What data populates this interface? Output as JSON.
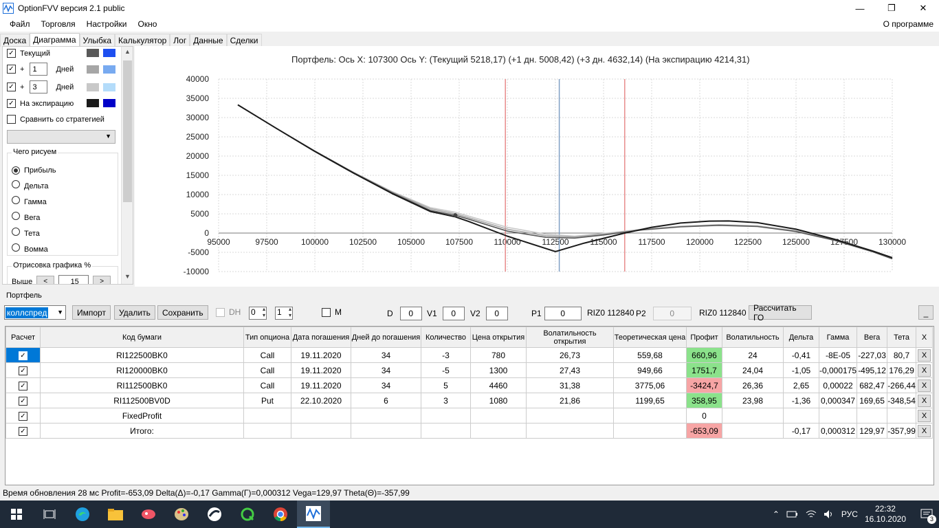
{
  "window": {
    "title": "OptionFVV версия 2.1 public",
    "controls": [
      "—",
      "❐",
      "✕"
    ]
  },
  "menu": {
    "items": [
      "Файл",
      "Торговля",
      "Настройки",
      "Окно"
    ],
    "about": "О программе"
  },
  "tabs": [
    "Доска",
    "Диаграмма",
    "Улыбка",
    "Калькулятор",
    "Лог",
    "Данные",
    "Сделки"
  ],
  "active_tab": "Диаграмма",
  "left_panel": {
    "current_label": "Текущий",
    "plus_sign": "+",
    "days_label": "Дней",
    "day1_value": "1",
    "day3_value": "3",
    "expiration_label": "На экспирацию",
    "compare_label": "Сравнить со стратегией",
    "draw_group_title": "Чего рисуем",
    "draw_options": [
      "Прибыль",
      "Дельта",
      "Гамма",
      "Вега",
      "Тета",
      "Вомма"
    ],
    "draw_selected": "Прибыль",
    "render_group_title": "Отрисовка графика %",
    "above_label": "Выше",
    "above_value": "15",
    "btn_less": "<",
    "btn_more": ">",
    "swatches": {
      "current": [
        "#595959",
        "#1e4ff0"
      ],
      "day1": [
        "#a6a6a6",
        "#78aaf0"
      ],
      "day3": [
        "#c8c8c8",
        "#b4dcfa"
      ],
      "expiration": [
        "#1a1a1a",
        "#0000c8"
      ]
    }
  },
  "chart_header": "Портфель: Ось X: 107300 Ось Y:  (Текущий 5218,17)  (+1 дн. 5008,42)  (+3 дн. 4632,14)  (На экспирацию 4214,31)",
  "chart_data": {
    "type": "line",
    "xlim": [
      95000,
      130000
    ],
    "ylim": [
      -10000,
      40000
    ],
    "x_ticks": [
      "95000",
      "97500",
      "100000",
      "102500",
      "105000",
      "107500",
      "110000",
      "112500",
      "115000",
      "117500",
      "120000",
      "122500",
      "125000",
      "127500",
      "130000"
    ],
    "y_ticks": [
      "40000",
      "35000",
      "30000",
      "25000",
      "20000",
      "15000",
      "10000",
      "5000",
      "0",
      "-5000",
      "-10000"
    ],
    "grid": true,
    "markers": [
      {
        "x": 109900,
        "color": "#e88a8a"
      },
      {
        "x": 112700,
        "color": "#7f9fc4"
      },
      {
        "x": 116100,
        "color": "#e88a8a"
      }
    ],
    "cursor_point": {
      "x": 107300,
      "y": 4632
    },
    "series": [
      {
        "color": "#c8c8c8",
        "x": [
          96000,
          98000,
          100000,
          102000,
          104000,
          106000,
          107300,
          108000,
          110000,
          112000,
          113500,
          115000,
          117000,
          119000,
          121000,
          123000,
          125000,
          127000,
          129000,
          130000
        ],
        "y": [
          33300,
          27200,
          21300,
          15800,
          10800,
          6600,
          5400,
          4400,
          1500,
          -300,
          -800,
          -100,
          1000,
          1800,
          2200,
          1900,
          600,
          -1600,
          -4600,
          -6400
        ]
      },
      {
        "color": "#a6a6a6",
        "x": [
          96000,
          98000,
          100000,
          102000,
          104000,
          106000,
          107300,
          108000,
          110000,
          112000,
          113500,
          115000,
          117000,
          119000,
          121000,
          123000,
          125000,
          127000,
          129000,
          130000
        ],
        "y": [
          33300,
          27200,
          21300,
          15800,
          10700,
          6300,
          5000,
          4000,
          1000,
          -700,
          -1000,
          -300,
          900,
          1700,
          2100,
          1800,
          500,
          -1800,
          -4800,
          -6600
        ]
      },
      {
        "color": "#595959",
        "x": [
          96000,
          98000,
          100000,
          102000,
          104000,
          106000,
          107300,
          108000,
          110000,
          112000,
          113500,
          115000,
          117000,
          119000,
          121000,
          123000,
          125000,
          127000,
          129000,
          130000
        ],
        "y": [
          33300,
          27200,
          21300,
          15700,
          10500,
          5900,
          4632,
          3600,
          500,
          -1100,
          -1300,
          -500,
          800,
          1600,
          2000,
          1700,
          400,
          -1900,
          -4900,
          -6700
        ]
      },
      {
        "color": "#1a1a1a",
        "x": [
          96000,
          98000,
          100000,
          102000,
          104000,
          106000,
          107300,
          108000,
          110000,
          112500,
          114000,
          116100,
          117500,
          119000,
          120500,
          121500,
          123000,
          125000,
          127000,
          129000,
          130000
        ],
        "y": [
          33300,
          27200,
          21200,
          15600,
          10300,
          5600,
          4214,
          3000,
          -800,
          -4800,
          -2600,
          0,
          1500,
          2600,
          3100,
          3150,
          2700,
          1000,
          -1600,
          -4700,
          -6400
        ]
      }
    ]
  },
  "portfolio": {
    "label": "Портфель",
    "selected": "коллспред",
    "import_btn": "Импорт",
    "delete_btn": "Удалить",
    "save_btn": "Сохранить",
    "dh_label": "DH",
    "spin1": "0",
    "spin2": "1",
    "m_label": "M",
    "d_label": "D",
    "d_value": "0",
    "v1_label": "V1",
    "v1_value": "0",
    "v2_label": "V2",
    "v2_value": "0",
    "p1_label": "P1",
    "p1_value": "0",
    "riz1": "RIZ0 112840",
    "p2_label": "P2",
    "p2_value": "0",
    "riz2": "RIZ0 112840",
    "calc_btn": "Рассчитать ГО",
    "minimize_btn": "_"
  },
  "grid": {
    "headers": [
      "Расчет",
      "Код бумаги",
      "Тип опциона",
      "Дата погашения",
      "Дней до погашения",
      "Количество",
      "Цена открытия",
      "Волатильность открытия",
      "Теоретическая цена",
      "Профит",
      "Волатильность",
      "Дельта",
      "Гамма",
      "Вега",
      "Тета",
      "X"
    ],
    "rows": [
      {
        "code": "RI122500BK0",
        "type": "Call",
        "date": "19.11.2020",
        "days": "34",
        "qty": "-3",
        "price": "780",
        "vol_open": "26,73",
        "theo": "559,68",
        "profit": "660,96",
        "profit_cls": "pos",
        "vol": "24",
        "delta": "-0,41",
        "gamma": "-8E-05",
        "vega": "-227,03",
        "theta": "80,7",
        "x": "X"
      },
      {
        "code": "RI120000BK0",
        "type": "Call",
        "date": "19.11.2020",
        "days": "34",
        "qty": "-5",
        "price": "1300",
        "vol_open": "27,43",
        "theo": "949,66",
        "profit": "1751,7",
        "profit_cls": "pos",
        "vol": "24,04",
        "delta": "-1,05",
        "gamma": "-0,000175",
        "vega": "-495,12",
        "theta": "176,29",
        "x": "X"
      },
      {
        "code": "RI112500BK0",
        "type": "Call",
        "date": "19.11.2020",
        "days": "34",
        "qty": "5",
        "price": "4460",
        "vol_open": "31,38",
        "theo": "3775,06",
        "profit": "-3424,7",
        "profit_cls": "neg",
        "vol": "26,36",
        "delta": "2,65",
        "gamma": "0,00022",
        "vega": "682,47",
        "theta": "-266,44",
        "x": "X"
      },
      {
        "code": "RI112500BV0D",
        "type": "Put",
        "date": "22.10.2020",
        "days": "6",
        "qty": "3",
        "price": "1080",
        "vol_open": "21,86",
        "theo": "1199,65",
        "profit": "358,95",
        "profit_cls": "pos",
        "vol": "23,98",
        "delta": "-1,36",
        "gamma": "0,000347",
        "vega": "169,65",
        "theta": "-348,54",
        "x": "X"
      },
      {
        "code": "FixedProfit",
        "type": "",
        "date": "",
        "days": "",
        "qty": "",
        "price": "",
        "vol_open": "",
        "theo": "",
        "profit": "0",
        "profit_cls": "",
        "vol": "",
        "delta": "",
        "gamma": "",
        "vega": "",
        "theta": "",
        "x": "X"
      },
      {
        "code": "Итого:",
        "type": "",
        "date": "",
        "days": "",
        "qty": "",
        "price": "",
        "vol_open": "",
        "theo": "",
        "profit": "-653,09",
        "profit_cls": "neg",
        "vol": "",
        "delta": "-0,17",
        "gamma": "0,000312",
        "vega": "129,97",
        "theta": "-357,99",
        "x": "X"
      }
    ]
  },
  "status": "Время обновления 28 мс  Profit=-653,09 Delta(Δ)=-0,17 Gamma(Γ)=0,000312 Vega=129,97 Theta(Θ)=-357,99",
  "taskbar": {
    "lang": "РУС",
    "time": "22:32",
    "date": "16.10.2020",
    "notifications": "3"
  }
}
